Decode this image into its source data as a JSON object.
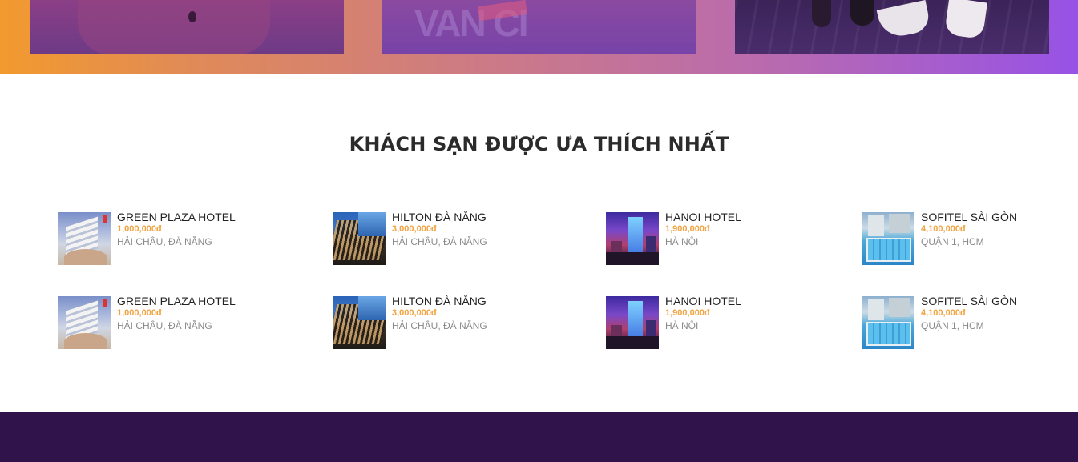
{
  "hero": {
    "cards": [
      {
        "name": "hero-card-1"
      },
      {
        "name": "hero-card-2",
        "overlay_text": "VAN CI"
      },
      {
        "name": "hero-card-3"
      }
    ],
    "gradient": [
      "#f29a2e",
      "#9752e6"
    ]
  },
  "section": {
    "title": "KHÁCH SẠN ĐƯỢC ƯA THÍCH NHẤT"
  },
  "colors": {
    "price": "#f0a340",
    "footer": "#30134b"
  },
  "hotels": [
    {
      "name": "GREEN PLAZA HOTEL",
      "price": "1,000,000đ",
      "location": "HẢI CHÂU, ĐÀ NẴNG"
    },
    {
      "name": "HILTON ĐÀ NẴNG",
      "price": "3,000,000đ",
      "location": "HẢI CHÂU, ĐÀ NẴNG"
    },
    {
      "name": "HANOI HOTEL",
      "price": "1,900,000đ",
      "location": "HÀ NỘI"
    },
    {
      "name": "SOFITEL SÀI GÒN",
      "price": "4,100,000đ",
      "location": "QUẬN 1, HCM"
    },
    {
      "name": "GREEN PLAZA HOTEL",
      "price": "1,000,000đ",
      "location": "HẢI CHÂU, ĐÀ NẴNG"
    },
    {
      "name": "HILTON ĐÀ NẴNG",
      "price": "3,000,000đ",
      "location": "HẢI CHÂU, ĐÀ NẴNG"
    },
    {
      "name": "HANOI HOTEL",
      "price": "1,900,000đ",
      "location": "HÀ NỘI"
    },
    {
      "name": "SOFITEL SÀI GÒN",
      "price": "4,100,000đ",
      "location": "QUẬN 1, HCM"
    }
  ]
}
